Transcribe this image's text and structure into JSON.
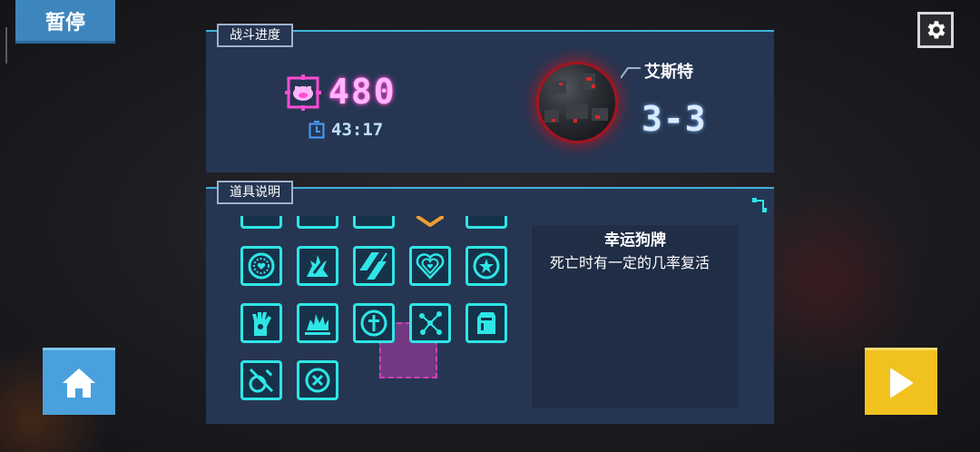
{
  "hud": {
    "pause_label": "暂停",
    "settings_icon": "gear-icon",
    "home_icon": "home-icon",
    "play_icon": "play-icon"
  },
  "battle_progress": {
    "tab_label": "战斗进度",
    "score": "480",
    "score_color": "#ffb6ff",
    "score_icon": "pig-target-icon",
    "time": "43:17",
    "time_icon": "stopwatch-icon",
    "boss_name": "艾斯特",
    "stage": "3-3",
    "boss_glow_color": "#d22a2a"
  },
  "item_description": {
    "tab_label": "道具说明",
    "items": [
      {
        "name": "item-partial-1",
        "icon": "partial-icon"
      },
      {
        "name": "item-partial-2",
        "icon": "partial-icon"
      },
      {
        "name": "item-partial-3",
        "icon": "partial-icon"
      },
      {
        "name": "item-partial-4",
        "icon": "chevron-badge-icon"
      },
      {
        "name": "item-partial-5",
        "icon": "partial-icon"
      },
      {
        "name": "item-heart-ring",
        "icon": "heart-ring-icon"
      },
      {
        "name": "item-flame-sword",
        "icon": "flame-sword-icon"
      },
      {
        "name": "item-slash",
        "icon": "slash-icon"
      },
      {
        "name": "item-layered-heart",
        "icon": "layered-heart-icon"
      },
      {
        "name": "item-star-badge",
        "icon": "star-badge-icon"
      },
      {
        "name": "item-glove",
        "icon": "glove-icon"
      },
      {
        "name": "item-explosion",
        "icon": "explosion-icon"
      },
      {
        "name": "item-dog-tag",
        "icon": "cross-tag-icon",
        "selected": true
      },
      {
        "name": "item-network",
        "icon": "network-icon"
      },
      {
        "name": "item-fist",
        "icon": "fist-icon"
      },
      {
        "name": "item-sword-shield",
        "icon": "sword-shield-icon"
      },
      {
        "name": "item-cancel",
        "icon": "x-circle-icon"
      }
    ],
    "accent_color": "#2ee6e6",
    "selected_title": "幸运狗牌",
    "selected_desc": "死亡时有一定的几率复活"
  }
}
